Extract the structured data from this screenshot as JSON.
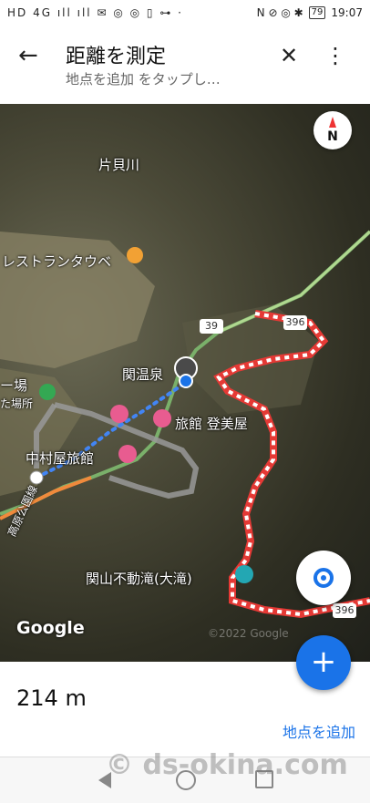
{
  "status": {
    "left": "HD 4G ıll ıll ✉ ◎ ◎ ▯ ⊶ ·",
    "right_icons": "N ⊘ ◎ ✱",
    "battery": "79",
    "time": "19:07"
  },
  "appbar": {
    "title": "距離を測定",
    "subtitle": "地点を追加 をタップし…"
  },
  "map": {
    "labels": {
      "river": "片貝川",
      "restaurant": "レストランタウベ",
      "hot_spring": "関温泉",
      "ryokan_tomiya": "旅館 登美屋",
      "nakamuraya": "中村屋旅館",
      "plaza_top": "ー場",
      "plaza_bottom": "た場所",
      "park_road": "高原公園線",
      "waterfall": "関山不動滝(大滝)"
    },
    "road_badges": {
      "r39": "39",
      "r396a": "396",
      "r396b": "396"
    },
    "compass_letter": "N",
    "google_logo": "Google",
    "copyright": "©2022 Google"
  },
  "measurement": {
    "distance": "214 m",
    "add_point": "地点を追加"
  },
  "watermark": "© ds-okina.com",
  "colors": {
    "accent": "#1a73e8",
    "route": "#e53935",
    "path": "#4285f4"
  }
}
